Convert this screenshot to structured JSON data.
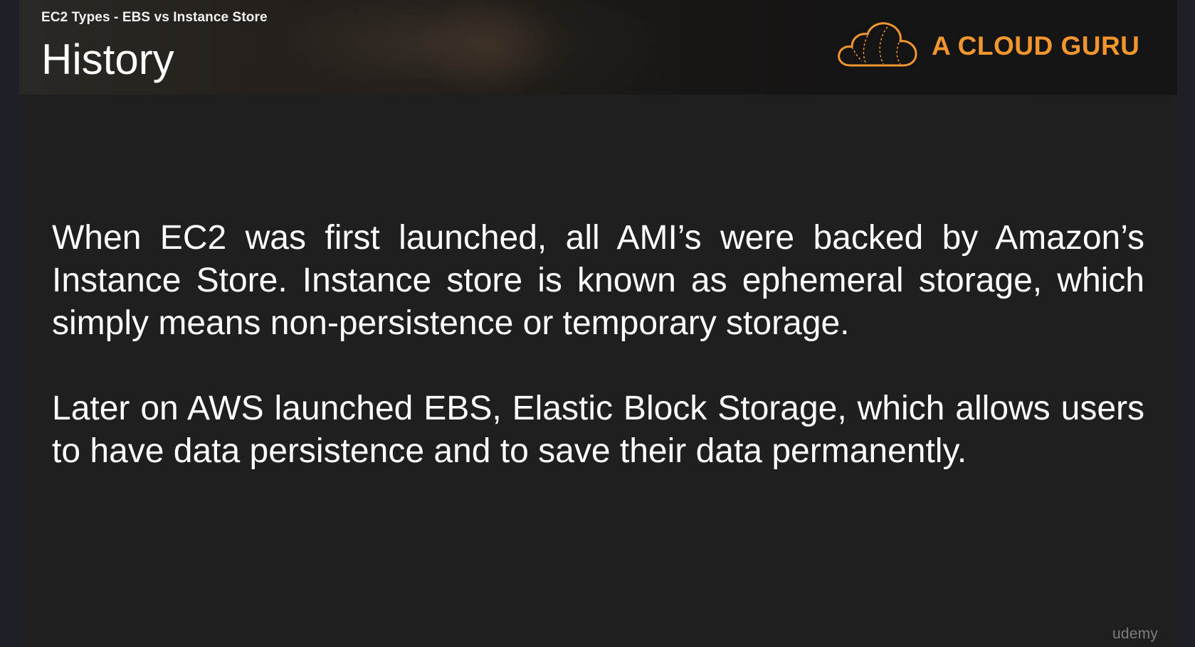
{
  "slide": {
    "subtitle": "EC2 Types - EBS vs Instance Store",
    "title": "History",
    "logo": {
      "text": "A CLOUD GURU",
      "icon": "cloud-icon",
      "color": "#f1962f"
    },
    "paragraphs": [
      "When EC2 was first launched, all AMI’s were backed by Amazon’s Instance Store. Instance store is known as ephemeral storage, which simply means non-persistence or temporary storage.",
      "Later on AWS launched EBS, Elastic Block Storage, which allows users to have data persistence and to save their data permanently."
    ]
  },
  "watermark": "udemy",
  "colors": {
    "slide_background": "#1f1f1f",
    "text": "#ffffff",
    "brand_accent": "#f1962f"
  }
}
